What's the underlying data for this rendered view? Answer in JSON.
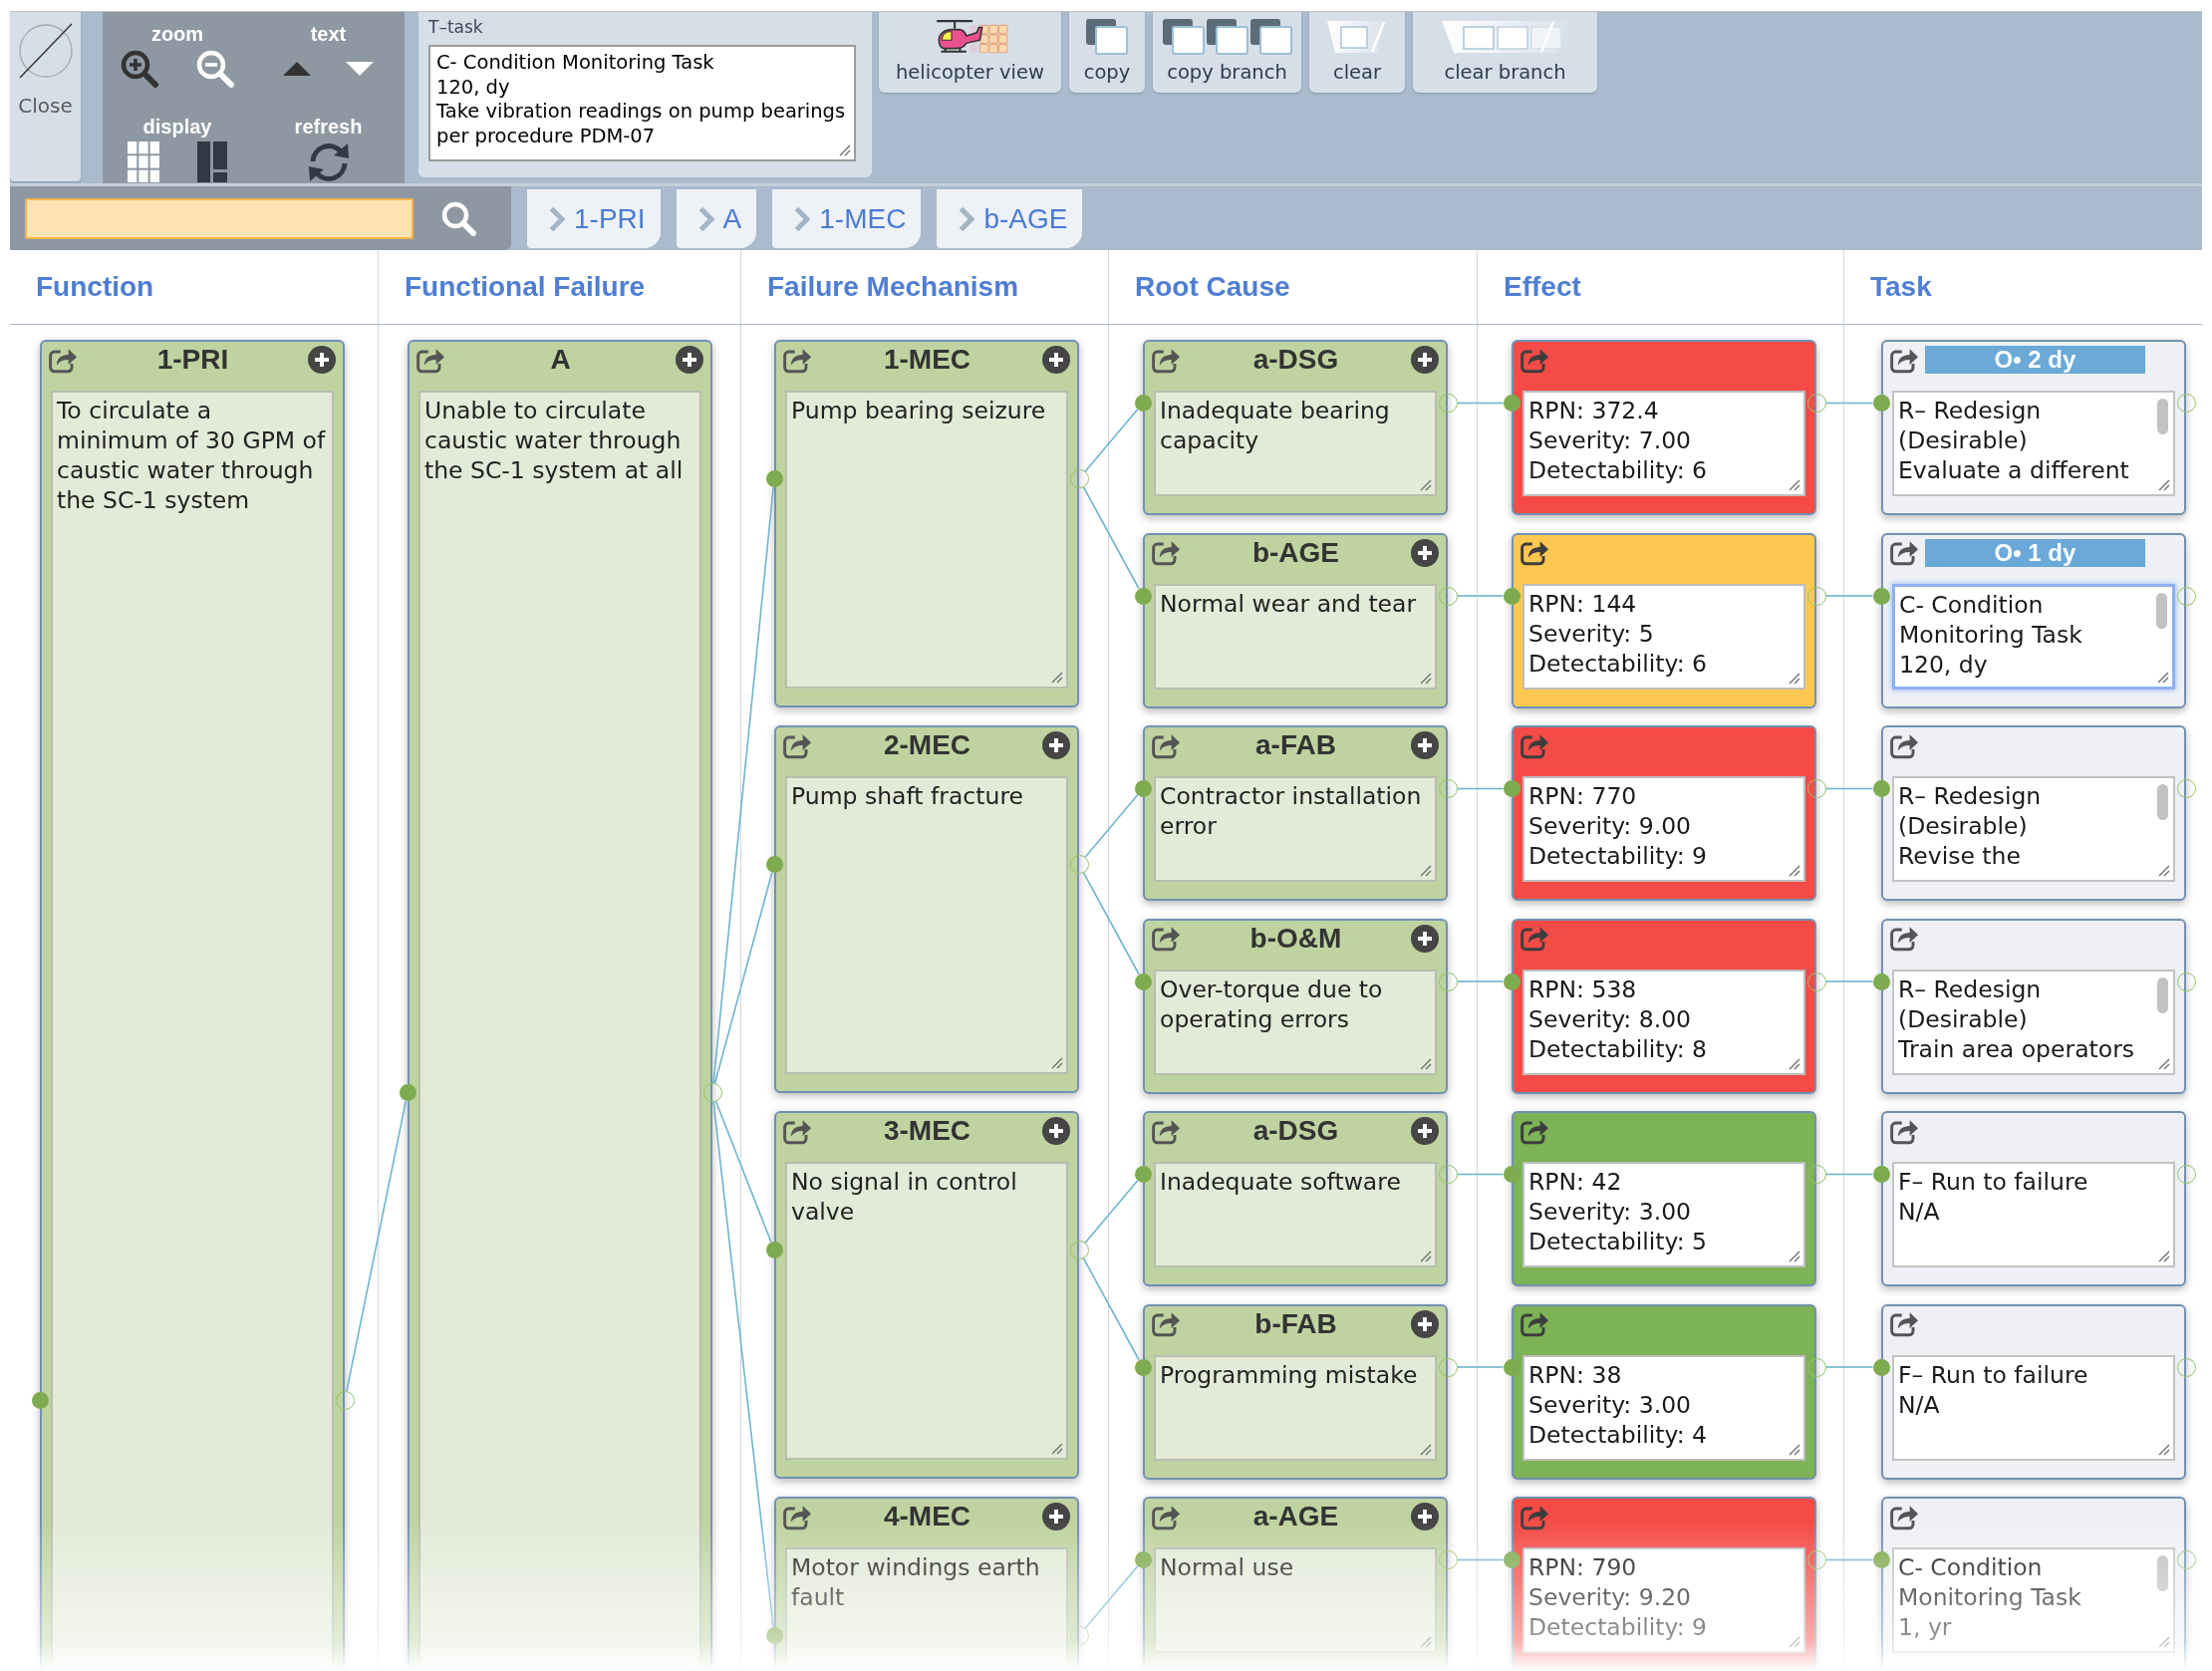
{
  "close_button": {
    "label": "Close"
  },
  "view_controls": [
    {
      "label": "zoom",
      "kind": "zoom"
    },
    {
      "label": "text",
      "kind": "text_size"
    },
    {
      "label": "display",
      "kind": "display"
    },
    {
      "label": "refresh",
      "kind": "refresh"
    }
  ],
  "task_panel": {
    "label": "T–task",
    "lines": [
      "C- Condition Monitoring Task",
      "120, dy",
      "Take vibration readings on pump bearings",
      "per procedure PDM-07"
    ]
  },
  "toolbar_buttons": [
    {
      "label": "helicopter view",
      "kind": "helicopter"
    },
    {
      "label": "copy",
      "kind": "copy"
    },
    {
      "label": "copy branch",
      "kind": "copy_branch"
    },
    {
      "label": "clear",
      "kind": "clear"
    },
    {
      "label": "clear branch",
      "kind": "clear_branch"
    }
  ],
  "breadcrumbs": [
    "1-PRI",
    "A",
    "1-MEC",
    "b-AGE"
  ],
  "columns": [
    "Function",
    "Functional Failure",
    "Failure Mechanism",
    "Root Cause",
    "Effect",
    "Task"
  ],
  "functions": [
    {
      "code": "1-PRI",
      "lines": [
        "To circulate a",
        "minimum of 30 GPM of",
        "caustic water through",
        "the SC-1 system"
      ],
      "failures": [
        {
          "code": "A",
          "lines": [
            "Unable to circulate",
            "caustic water through",
            "the SC-1 system at all"
          ],
          "mechanisms": [
            {
              "code": "1-MEC",
              "lines": [
                "Pump bearing seizure"
              ],
              "causes": [
                {
                  "code": "a-DSG",
                  "lines": [
                    "Inadequate bearing",
                    "capacity"
                  ],
                  "effect": {
                    "color": "#f44b46",
                    "lines": [
                      "RPN: 372.4",
                      "Severity: 7.00",
                      "Detectability: 6"
                    ]
                  },
                  "task": {
                    "badge": "O• 2 dy",
                    "lines": [
                      "R– Redesign",
                      "(Desirable)",
                      "Evaluate a different"
                    ],
                    "scrollable": true,
                    "selected": false
                  }
                },
                {
                  "code": "b-AGE",
                  "lines": [
                    "Normal wear and tear"
                  ],
                  "effect": {
                    "color": "#fec850",
                    "lines": [
                      "RPN: 144",
                      "Severity: 5",
                      "Detectability: 6"
                    ]
                  },
                  "task": {
                    "badge": "O• 1 dy",
                    "lines": [
                      "C- Condition",
                      "Monitoring Task",
                      "120, dy"
                    ],
                    "scrollable": true,
                    "selected": true
                  }
                }
              ]
            },
            {
              "code": "2-MEC",
              "lines": [
                "Pump shaft fracture"
              ],
              "causes": [
                {
                  "code": "a-FAB",
                  "lines": [
                    "Contractor installation",
                    "error"
                  ],
                  "effect": {
                    "color": "#f44b46",
                    "lines": [
                      "RPN: 770",
                      "Severity: 9.00",
                      "Detectability: 9"
                    ]
                  },
                  "task": {
                    "lines": [
                      "R– Redesign",
                      "(Desirable)",
                      "Revise the"
                    ],
                    "scrollable": true,
                    "selected": false
                  }
                },
                {
                  "code": "b-O&M",
                  "lines": [
                    "Over-torque due to",
                    "operating errors"
                  ],
                  "effect": {
                    "color": "#f44b46",
                    "lines": [
                      "RPN: 538",
                      "Severity: 8.00",
                      "Detectability: 8"
                    ]
                  },
                  "task": {
                    "lines": [
                      "R– Redesign",
                      "(Desirable)",
                      "Train area operators"
                    ],
                    "scrollable": true,
                    "selected": false
                  }
                }
              ]
            },
            {
              "code": "3-MEC",
              "lines": [
                "No signal in control",
                "valve"
              ],
              "causes": [
                {
                  "code": "a-DSG",
                  "lines": [
                    "Inadequate software"
                  ],
                  "effect": {
                    "color": "#7cb356",
                    "lines": [
                      "RPN: 42",
                      "Severity: 3.00",
                      "Detectability: 5"
                    ]
                  },
                  "task": {
                    "lines": [
                      "F– Run to failure",
                      "N/A"
                    ],
                    "scrollable": false,
                    "selected": false
                  }
                },
                {
                  "code": "b-FAB",
                  "lines": [
                    "Programming mistake"
                  ],
                  "effect": {
                    "color": "#7cb356",
                    "lines": [
                      "RPN: 38",
                      "Severity: 3.00",
                      "Detectability: 4"
                    ]
                  },
                  "task": {
                    "lines": [
                      "F– Run to failure",
                      "N/A"
                    ],
                    "scrollable": false,
                    "selected": false
                  }
                }
              ]
            },
            {
              "code": "4-MEC",
              "lines": [
                "Motor windings earth",
                "fault"
              ],
              "causes": [
                {
                  "code": "a-AGE",
                  "lines": [
                    "Normal use"
                  ],
                  "effect": {
                    "color": "#f44b46",
                    "lines": [
                      "RPN: 790",
                      "Severity: 9.20",
                      "Detectability: 9"
                    ]
                  },
                  "task": {
                    "lines": [
                      "C- Condition",
                      "Monitoring Task",
                      "1, yr"
                    ],
                    "scrollable": true,
                    "selected": false
                  }
                }
              ]
            }
          ]
        }
      ]
    }
  ]
}
